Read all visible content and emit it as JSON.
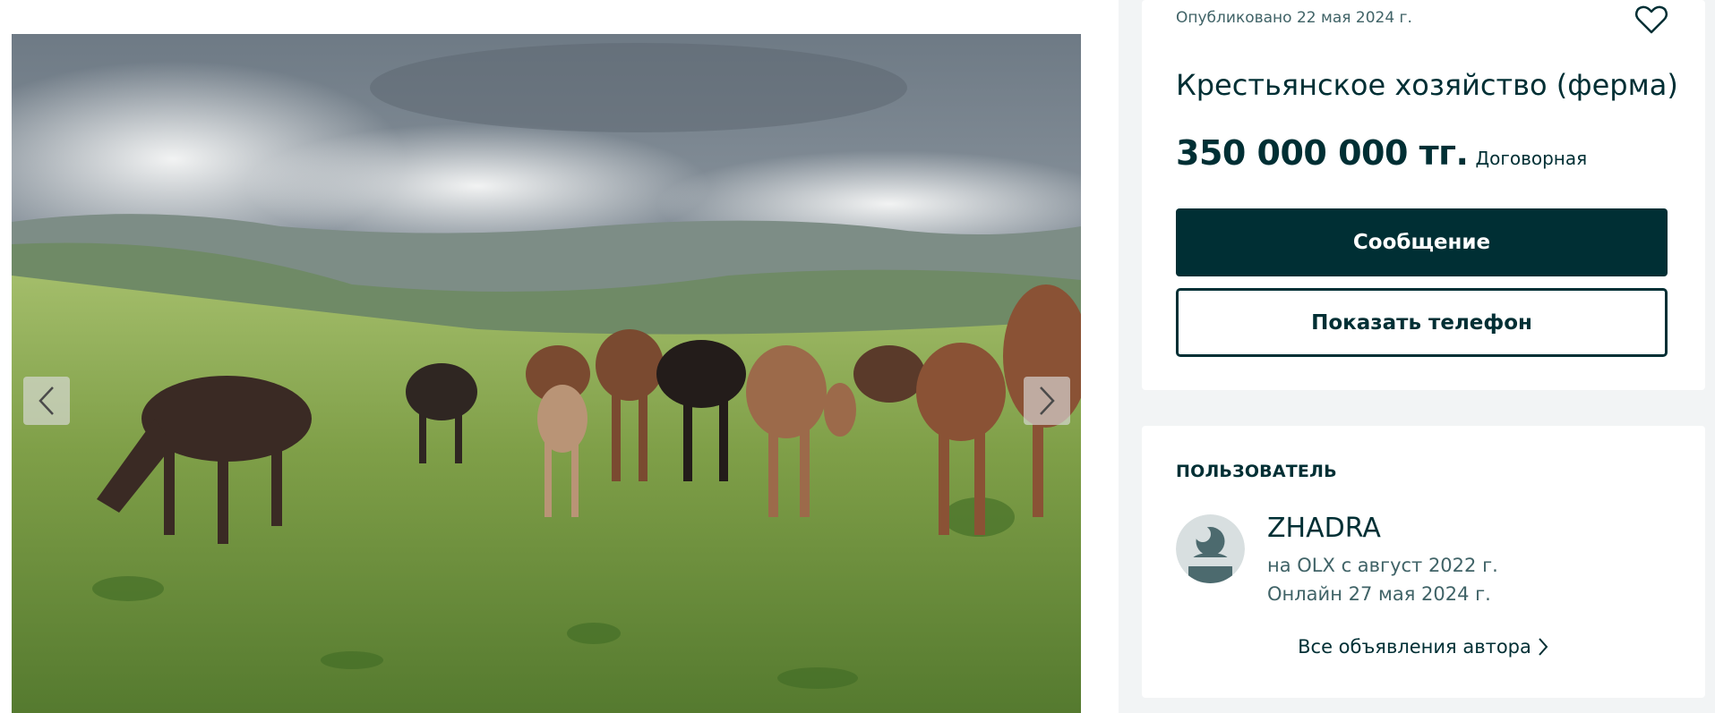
{
  "gallery": {
    "image_alt": "Табун лошадей на пастбище",
    "prev_icon": "chevron-left-icon",
    "next_icon": "chevron-right-icon"
  },
  "offer": {
    "posted": "Опубликовано 22 мая 2024 г.",
    "favorite_icon": "heart-icon",
    "title": "Крестьянское хозяйство (ферма)",
    "price": "350 000 000 тг.",
    "price_note": "Договорная",
    "message_button": "Сообщение",
    "phone_button": "Показать телефон"
  },
  "user": {
    "heading": "ПОЛЬЗОВАТЕЛЬ",
    "name": "ZHADRA",
    "since": "на OLX с август 2022 г.",
    "online": "Онлайн 27 мая 2024 г.",
    "all_ads": "Все объявления автора",
    "avatar_icon": "user-avatar-icon"
  },
  "colors": {
    "primary": "#002f34",
    "secondary_text": "#406367",
    "page_bg": "#f2f4f5",
    "card_bg": "#ffffff"
  }
}
